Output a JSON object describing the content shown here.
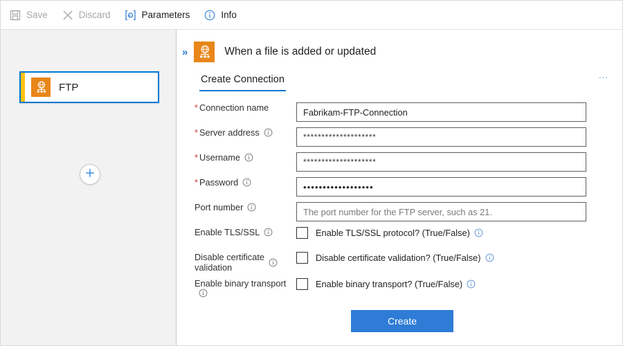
{
  "toolbar": {
    "items": [
      {
        "label": "Save",
        "icon": "save-icon",
        "enabled": false
      },
      {
        "label": "Discard",
        "icon": "discard-icon",
        "enabled": false
      },
      {
        "label": "Parameters",
        "icon": "parameters-icon",
        "enabled": true
      },
      {
        "label": "Info",
        "icon": "info-icon",
        "enabled": true
      }
    ]
  },
  "left_panel": {
    "card": {
      "label": "FTP",
      "icon": "ftp-globe-icon",
      "accent_color": "#ffc20e",
      "icon_bg": "#e8861a",
      "border_color": "#0078d4"
    },
    "add_button": {
      "icon": "plus-icon",
      "label": ""
    }
  },
  "detail_panel": {
    "collapse_icon": "chevron-double-right-icon",
    "header_icon": "ftp-globe-icon",
    "title": "When a file is added or updated",
    "more_menu": "…",
    "tabs": [
      {
        "label": "Create Connection",
        "active": true
      }
    ],
    "form": {
      "fields": [
        {
          "name": "connection-name",
          "label": "Connection name",
          "required": true,
          "has_info": false,
          "control": "text",
          "value": "Fabrikam-FTP-Connection",
          "placeholder": ""
        },
        {
          "name": "server-address",
          "label": "Server address",
          "required": true,
          "has_info": true,
          "control": "masked",
          "value": "********************",
          "placeholder": ""
        },
        {
          "name": "username",
          "label": "Username",
          "required": true,
          "has_info": true,
          "control": "masked",
          "value": "********************",
          "placeholder": ""
        },
        {
          "name": "password",
          "label": "Password",
          "required": true,
          "has_info": true,
          "control": "password",
          "value": "••••••••••••••••••",
          "placeholder": ""
        },
        {
          "name": "port-number",
          "label": "Port number",
          "required": false,
          "has_info": true,
          "control": "text",
          "value": "",
          "placeholder": "The port number for the FTP server, such as 21."
        },
        {
          "name": "enable-tls-ssl",
          "label": "Enable TLS/SSL",
          "required": false,
          "has_info": true,
          "control": "checkbox",
          "checked": false,
          "checkbox_label": "Enable TLS/SSL protocol? (True/False)",
          "checkbox_label_has_info": true
        },
        {
          "name": "disable-certificate-validation",
          "label": "Disable certificate\nvalidation",
          "required": false,
          "has_info": true,
          "control": "checkbox",
          "checked": false,
          "checkbox_label": "Disable certificate validation? (True/False)",
          "checkbox_label_has_info": true
        },
        {
          "name": "enable-binary-transport",
          "label": "Enable binary transport",
          "required": false,
          "has_info": true,
          "control": "checkbox",
          "checked": false,
          "checkbox_label": "Enable binary transport? (True/False)",
          "checkbox_label_has_info": true
        }
      ],
      "submit_label": "Create",
      "submit_color": "#2e7cd6"
    }
  }
}
